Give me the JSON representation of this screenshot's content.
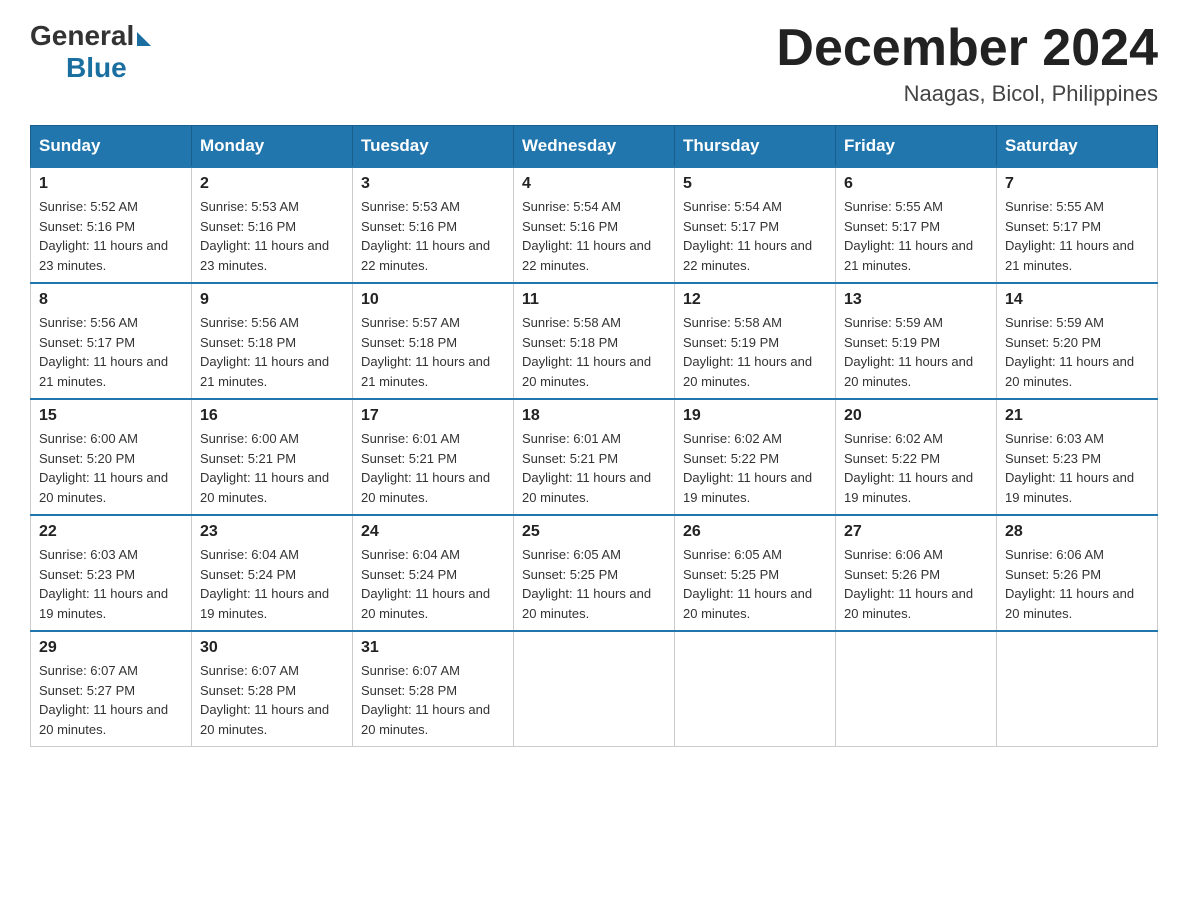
{
  "header": {
    "logo_general": "General",
    "logo_blue": "Blue",
    "month_year": "December 2024",
    "location": "Naagas, Bicol, Philippines"
  },
  "weekdays": [
    "Sunday",
    "Monday",
    "Tuesday",
    "Wednesday",
    "Thursday",
    "Friday",
    "Saturday"
  ],
  "weeks": [
    [
      {
        "day": "1",
        "sunrise": "5:52 AM",
        "sunset": "5:16 PM",
        "daylight": "11 hours and 23 minutes."
      },
      {
        "day": "2",
        "sunrise": "5:53 AM",
        "sunset": "5:16 PM",
        "daylight": "11 hours and 23 minutes."
      },
      {
        "day": "3",
        "sunrise": "5:53 AM",
        "sunset": "5:16 PM",
        "daylight": "11 hours and 22 minutes."
      },
      {
        "day": "4",
        "sunrise": "5:54 AM",
        "sunset": "5:16 PM",
        "daylight": "11 hours and 22 minutes."
      },
      {
        "day": "5",
        "sunrise": "5:54 AM",
        "sunset": "5:17 PM",
        "daylight": "11 hours and 22 minutes."
      },
      {
        "day": "6",
        "sunrise": "5:55 AM",
        "sunset": "5:17 PM",
        "daylight": "11 hours and 21 minutes."
      },
      {
        "day": "7",
        "sunrise": "5:55 AM",
        "sunset": "5:17 PM",
        "daylight": "11 hours and 21 minutes."
      }
    ],
    [
      {
        "day": "8",
        "sunrise": "5:56 AM",
        "sunset": "5:17 PM",
        "daylight": "11 hours and 21 minutes."
      },
      {
        "day": "9",
        "sunrise": "5:56 AM",
        "sunset": "5:18 PM",
        "daylight": "11 hours and 21 minutes."
      },
      {
        "day": "10",
        "sunrise": "5:57 AM",
        "sunset": "5:18 PM",
        "daylight": "11 hours and 21 minutes."
      },
      {
        "day": "11",
        "sunrise": "5:58 AM",
        "sunset": "5:18 PM",
        "daylight": "11 hours and 20 minutes."
      },
      {
        "day": "12",
        "sunrise": "5:58 AM",
        "sunset": "5:19 PM",
        "daylight": "11 hours and 20 minutes."
      },
      {
        "day": "13",
        "sunrise": "5:59 AM",
        "sunset": "5:19 PM",
        "daylight": "11 hours and 20 minutes."
      },
      {
        "day": "14",
        "sunrise": "5:59 AM",
        "sunset": "5:20 PM",
        "daylight": "11 hours and 20 minutes."
      }
    ],
    [
      {
        "day": "15",
        "sunrise": "6:00 AM",
        "sunset": "5:20 PM",
        "daylight": "11 hours and 20 minutes."
      },
      {
        "day": "16",
        "sunrise": "6:00 AM",
        "sunset": "5:21 PM",
        "daylight": "11 hours and 20 minutes."
      },
      {
        "day": "17",
        "sunrise": "6:01 AM",
        "sunset": "5:21 PM",
        "daylight": "11 hours and 20 minutes."
      },
      {
        "day": "18",
        "sunrise": "6:01 AM",
        "sunset": "5:21 PM",
        "daylight": "11 hours and 20 minutes."
      },
      {
        "day": "19",
        "sunrise": "6:02 AM",
        "sunset": "5:22 PM",
        "daylight": "11 hours and 19 minutes."
      },
      {
        "day": "20",
        "sunrise": "6:02 AM",
        "sunset": "5:22 PM",
        "daylight": "11 hours and 19 minutes."
      },
      {
        "day": "21",
        "sunrise": "6:03 AM",
        "sunset": "5:23 PM",
        "daylight": "11 hours and 19 minutes."
      }
    ],
    [
      {
        "day": "22",
        "sunrise": "6:03 AM",
        "sunset": "5:23 PM",
        "daylight": "11 hours and 19 minutes."
      },
      {
        "day": "23",
        "sunrise": "6:04 AM",
        "sunset": "5:24 PM",
        "daylight": "11 hours and 19 minutes."
      },
      {
        "day": "24",
        "sunrise": "6:04 AM",
        "sunset": "5:24 PM",
        "daylight": "11 hours and 20 minutes."
      },
      {
        "day": "25",
        "sunrise": "6:05 AM",
        "sunset": "5:25 PM",
        "daylight": "11 hours and 20 minutes."
      },
      {
        "day": "26",
        "sunrise": "6:05 AM",
        "sunset": "5:25 PM",
        "daylight": "11 hours and 20 minutes."
      },
      {
        "day": "27",
        "sunrise": "6:06 AM",
        "sunset": "5:26 PM",
        "daylight": "11 hours and 20 minutes."
      },
      {
        "day": "28",
        "sunrise": "6:06 AM",
        "sunset": "5:26 PM",
        "daylight": "11 hours and 20 minutes."
      }
    ],
    [
      {
        "day": "29",
        "sunrise": "6:07 AM",
        "sunset": "5:27 PM",
        "daylight": "11 hours and 20 minutes."
      },
      {
        "day": "30",
        "sunrise": "6:07 AM",
        "sunset": "5:28 PM",
        "daylight": "11 hours and 20 minutes."
      },
      {
        "day": "31",
        "sunrise": "6:07 AM",
        "sunset": "5:28 PM",
        "daylight": "11 hours and 20 minutes."
      },
      null,
      null,
      null,
      null
    ]
  ]
}
